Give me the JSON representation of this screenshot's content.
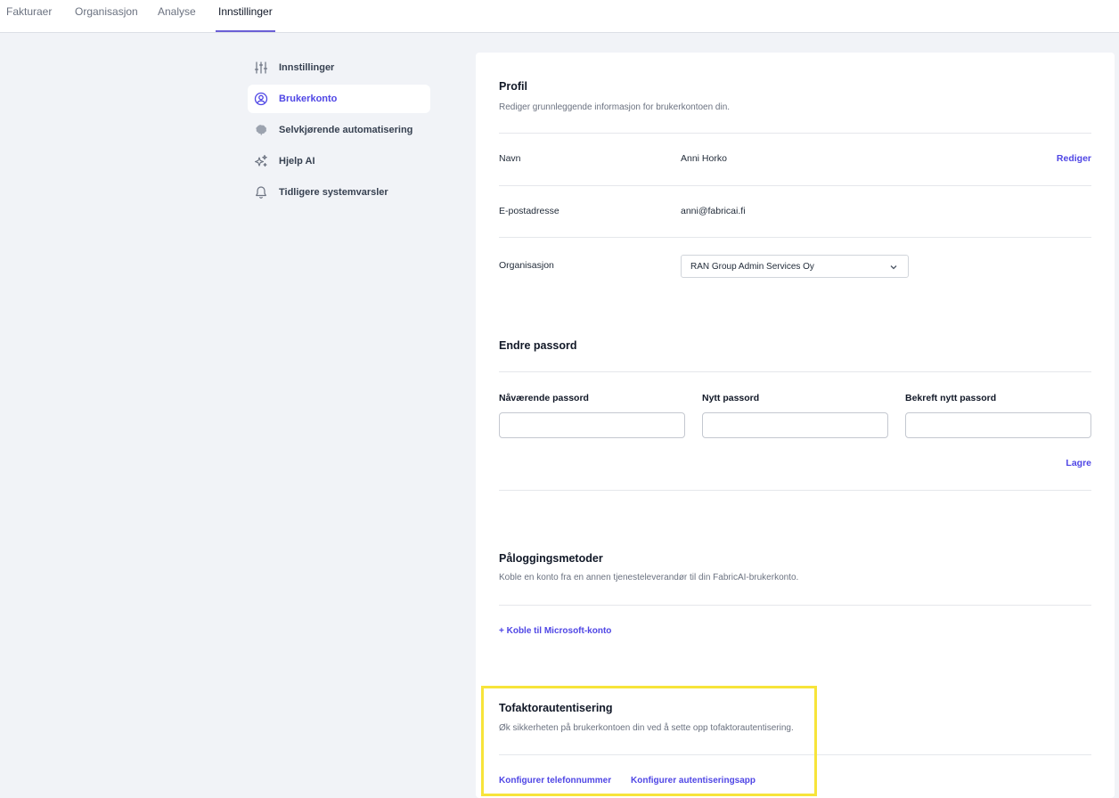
{
  "topnav": {
    "tabs": [
      {
        "label": "Fakturaer"
      },
      {
        "label": "Organisasjon"
      },
      {
        "label": "Analyse"
      },
      {
        "label": "Innstillinger",
        "active": true
      }
    ]
  },
  "sidebar": {
    "items": [
      {
        "label": "Innstillinger",
        "icon": "sliders-icon"
      },
      {
        "label": "Brukerkonto",
        "icon": "user-circle-icon",
        "active": true
      },
      {
        "label": "Selvkjørende automatisering",
        "icon": "brain-icon"
      },
      {
        "label": "Hjelp AI",
        "icon": "sparkles-icon"
      },
      {
        "label": "Tidligere systemvarsler",
        "icon": "bell-icon"
      }
    ]
  },
  "profile": {
    "title": "Profil",
    "description": "Rediger grunnleggende informasjon for brukerkontoen din.",
    "name_label": "Navn",
    "name_value": "Anni Horko",
    "edit_label": "Rediger",
    "email_label": "E-postadresse",
    "email_value": "anni@fabricai.fi",
    "org_label": "Organisasjon",
    "org_value": "RAN Group Admin Services Oy"
  },
  "password": {
    "title": "Endre passord",
    "current_label": "Nåværende passord",
    "new_label": "Nytt passord",
    "confirm_label": "Bekreft nytt passord",
    "save_label": "Lagre"
  },
  "login_methods": {
    "title": "Påloggingsmetoder",
    "description": "Koble en konto fra en annen tjenesteleverandør til din FabricAI-brukerkonto.",
    "microsoft_link": "+ Koble til Microsoft-konto"
  },
  "two_factor": {
    "title": "Tofaktorautentisering",
    "description": "Øk sikkerheten på brukerkontoen din ved å sette opp tofaktorautentisering.",
    "phone_link": "Konfigurer telefonnummer",
    "app_link": "Konfigurer autentiseringsapp"
  },
  "colors": {
    "accent": "#4f46e5",
    "highlight": "#f7e43a",
    "background": "#f1f3f7"
  }
}
